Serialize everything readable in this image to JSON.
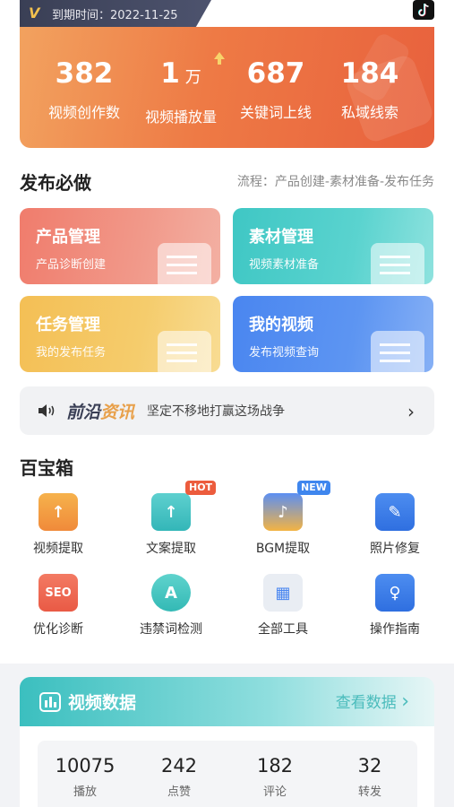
{
  "header": {
    "expiry_label": "到期时间：2022-11-25",
    "vlogo": "V",
    "tiktok_icon": "tiktok-icon"
  },
  "stats": [
    {
      "value": "382",
      "unit": "",
      "label": "视频创作数"
    },
    {
      "value": "1",
      "unit": "万",
      "label": "视频播放量"
    },
    {
      "value": "687",
      "unit": "",
      "label": "关键词上线"
    },
    {
      "value": "184",
      "unit": "",
      "label": "私域线索"
    }
  ],
  "publish": {
    "title": "发布必做",
    "flow": "流程：产品创建-素材准备-发布任务",
    "cards": [
      {
        "title": "产品管理",
        "subtitle": "产品诊断创建"
      },
      {
        "title": "素材管理",
        "subtitle": "视频素材准备"
      },
      {
        "title": "任务管理",
        "subtitle": "我的发布任务"
      },
      {
        "title": "我的视频",
        "subtitle": "发布视频查询"
      }
    ]
  },
  "news": {
    "brand_a": "前沿",
    "brand_b": "资讯",
    "message": "坚定不移地打赢这场战争",
    "chevron": "›"
  },
  "toolbox": {
    "title": "百宝箱",
    "items": [
      {
        "label": "视频提取",
        "badge": "",
        "glyph": "↑"
      },
      {
        "label": "文案提取",
        "badge": "HOT",
        "glyph": "↑"
      },
      {
        "label": "BGM提取",
        "badge": "NEW",
        "glyph": "♪"
      },
      {
        "label": "照片修复",
        "badge": "",
        "glyph": "✎"
      },
      {
        "label": "优化诊断",
        "badge": "",
        "glyph": "SEO"
      },
      {
        "label": "违禁词检测",
        "badge": "",
        "glyph": "A"
      },
      {
        "label": "全部工具",
        "badge": "",
        "glyph": "▦"
      },
      {
        "label": "操作指南",
        "badge": "",
        "glyph": "♀"
      }
    ]
  },
  "video_data": {
    "title": "视频数据",
    "more": "查看数据",
    "chevron": "›",
    "stats": [
      {
        "value": "10075",
        "label": "播放"
      },
      {
        "value": "242",
        "label": "点赞"
      },
      {
        "value": "182",
        "label": "评论"
      },
      {
        "value": "32",
        "label": "转发"
      }
    ]
  },
  "colors": {
    "accent_orange": "#ee7a45",
    "teal": "#3fc7c4",
    "blue": "#4a86f0",
    "yellow": "#f4bf55",
    "red": "#f07c6c"
  }
}
